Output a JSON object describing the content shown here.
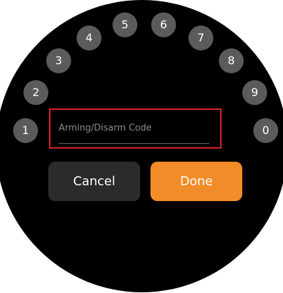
{
  "keypad": {
    "digits": [
      "1",
      "2",
      "3",
      "4",
      "5",
      "6",
      "7",
      "8",
      "9",
      "0"
    ]
  },
  "code_input": {
    "placeholder": "Arming/Disarm Code",
    "value": ""
  },
  "actions": {
    "cancel_label": "Cancel",
    "done_label": "Done"
  },
  "colors": {
    "background": "#000000",
    "digit_button": "#5b5b5b",
    "cancel_button": "#2b2b2b",
    "done_button": "#f28c28",
    "focus_outline": "#e0202a"
  }
}
